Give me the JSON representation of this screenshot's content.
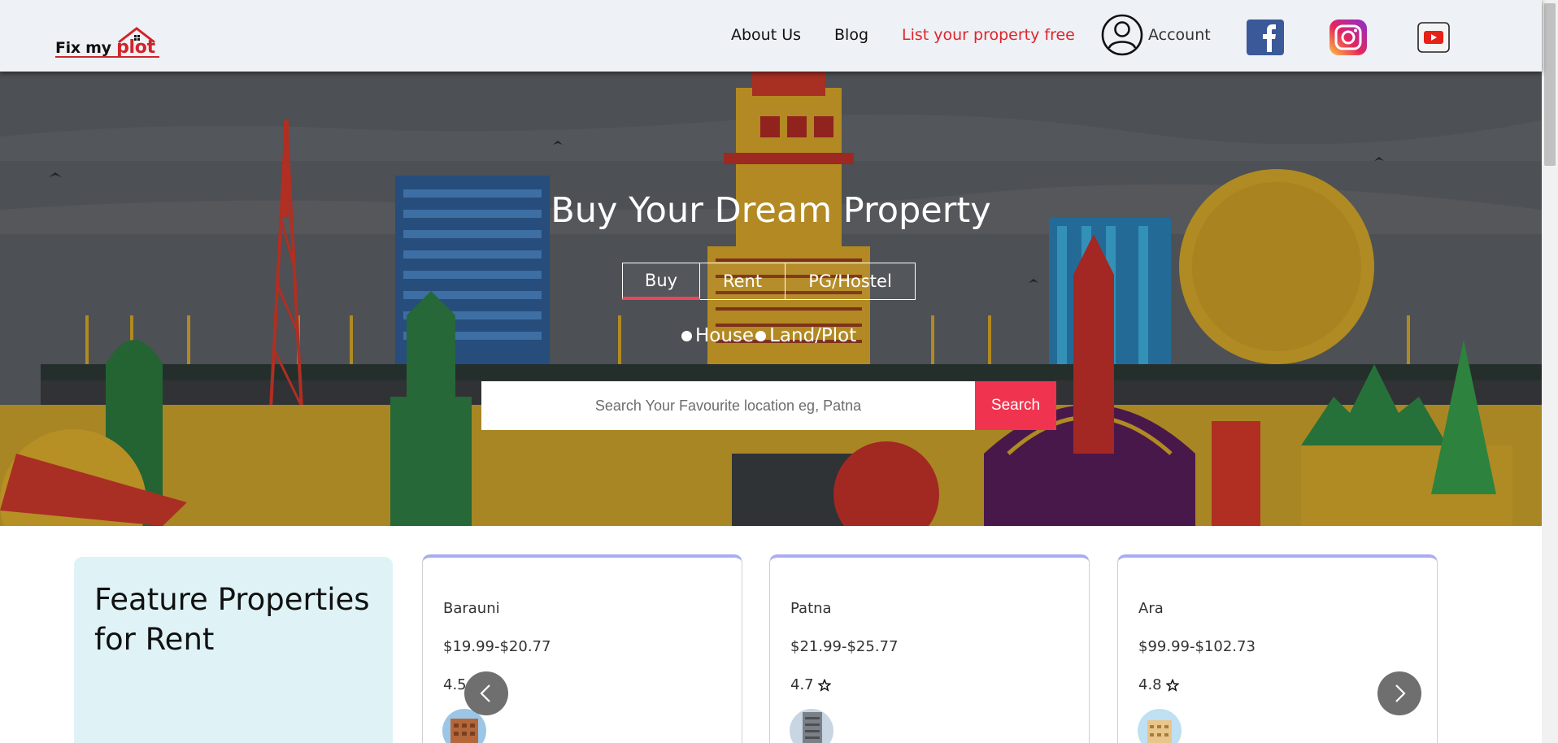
{
  "header": {
    "logo_text_prefix": "Fix my ",
    "logo_text_accent": "plot",
    "nav": {
      "about": "About Us",
      "blog": "Blog",
      "list_property": "List your property free"
    },
    "account_label": "Account",
    "social_icons": [
      "facebook-icon",
      "instagram-icon",
      "youtube-icon"
    ]
  },
  "hero": {
    "title": "Buy Your Dream Property",
    "tabs": [
      "Buy",
      "Rent",
      "PG/Hostel"
    ],
    "active_tab": "Buy",
    "property_types": [
      "House",
      "Land/Plot"
    ],
    "search": {
      "placeholder": "Search Your Favourite location eg, Patna",
      "value": "",
      "button_label": "Search"
    }
  },
  "featured": {
    "title": "Feature Properties for Rent",
    "cards": [
      {
        "location": "Barauni",
        "price": "$19.99-$20.77",
        "rating": "4.5"
      },
      {
        "location": "Patna",
        "price": "$21.99-$25.77",
        "rating": "4.7"
      },
      {
        "location": "Ara",
        "price": "$99.99-$102.73",
        "rating": "4.8"
      }
    ],
    "rating_icon": "star-icon",
    "carousel_icons": [
      "chevron-left-icon",
      "chevron-right-icon"
    ]
  },
  "colors": {
    "accent_red": "#e0242b",
    "search_button": "#f0344f",
    "tab_underline": "#f0445a",
    "card_top_border": "#a9acf2",
    "feature_box_bg": "#dff3f7",
    "header_bg": "#eef1f5"
  }
}
